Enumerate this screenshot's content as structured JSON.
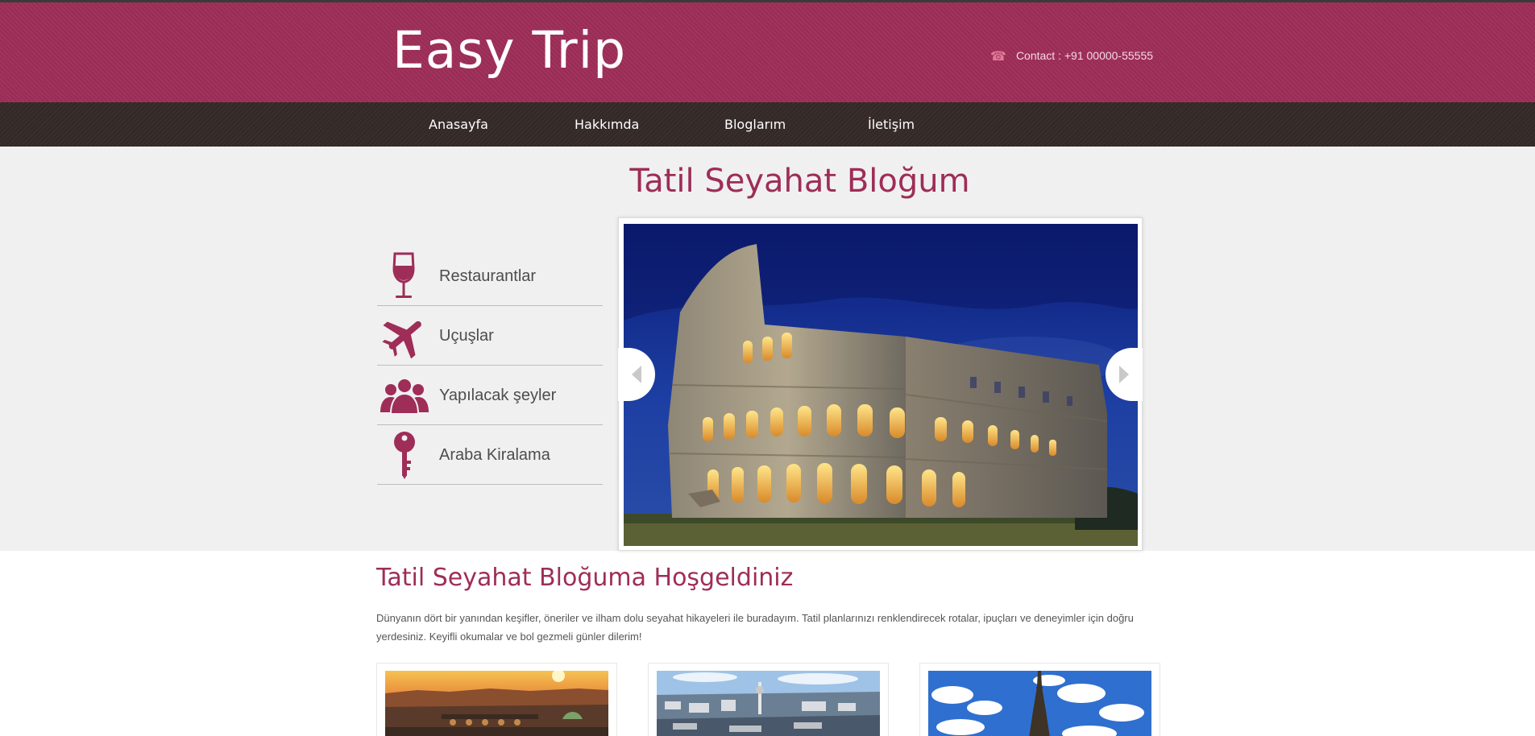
{
  "site": {
    "logo": "Easy Trip"
  },
  "contact": {
    "icon": "phone-icon",
    "text": "Contact : +91 00000-55555"
  },
  "nav": {
    "items": [
      {
        "label": "Anasayfa"
      },
      {
        "label": "Hakkımda"
      },
      {
        "label": "Bloglarım"
      },
      {
        "label": "İletişim"
      }
    ]
  },
  "hero": {
    "title": "Tatil Seyahat Bloğum",
    "services": [
      {
        "label": "Restaurantlar",
        "icon": "wine-glass-icon"
      },
      {
        "label": "Uçuşlar",
        "icon": "airplane-icon"
      },
      {
        "label": "Yapılacak şeyler",
        "icon": "people-icon"
      },
      {
        "label": "Araba Kiralama",
        "icon": "key-icon"
      }
    ],
    "slider": {
      "image": "colosseum-photo",
      "prev_icon": "arrow-left-icon",
      "next_icon": "arrow-right-icon"
    }
  },
  "welcome": {
    "title": "Tatil Seyahat Bloğuma Hoşgeldiniz",
    "text": "Dünyanın dört bir yanından keşifler, öneriler ve ilham dolu seyahat hikayeleri ile buradayım. Tatil planlarınızı renklendirecek rotalar, ipuçları ve deneyimler için doğru yerdesiniz. Keyifli okumalar ve bol gezmeli günler dilerim!"
  },
  "cards": [
    {
      "image": "prague-sunset-photo"
    },
    {
      "image": "berlin-cityscape-photo"
    },
    {
      "image": "eiffel-tower-photo"
    }
  ],
  "colors": {
    "brand": "#9e2d57",
    "nav_bg": "#352a28",
    "hero_bg": "#f0f0f0",
    "text": "#555555"
  }
}
